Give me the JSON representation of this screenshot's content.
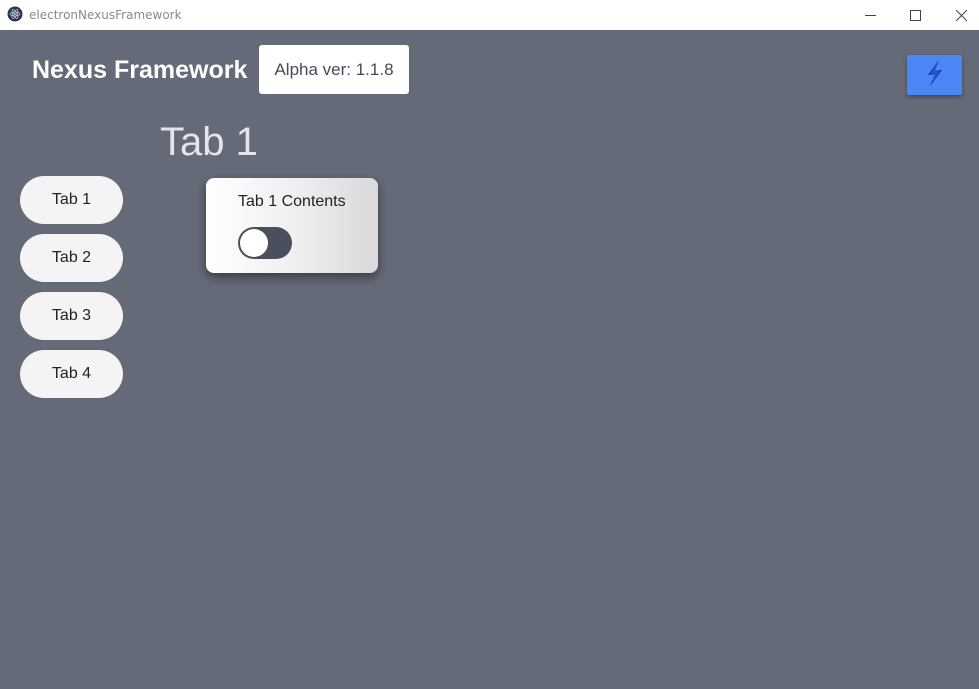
{
  "window": {
    "title": "electronNexusFramework"
  },
  "header": {
    "brand": "Nexus Framework",
    "version": "Alpha ver: 1.1.8",
    "action_icon": "lightning-bolt-icon"
  },
  "page": {
    "heading": "Tab 1"
  },
  "sidebar": {
    "tabs": [
      {
        "label": "Tab 1"
      },
      {
        "label": "Tab 2"
      },
      {
        "label": "Tab 3"
      },
      {
        "label": "Tab 4"
      }
    ]
  },
  "card": {
    "title": "Tab 1 Contents",
    "toggle_on": false
  },
  "colors": {
    "background": "#656a79",
    "accent": "#4c86f5",
    "toggle_track": "#4a4f5d"
  }
}
